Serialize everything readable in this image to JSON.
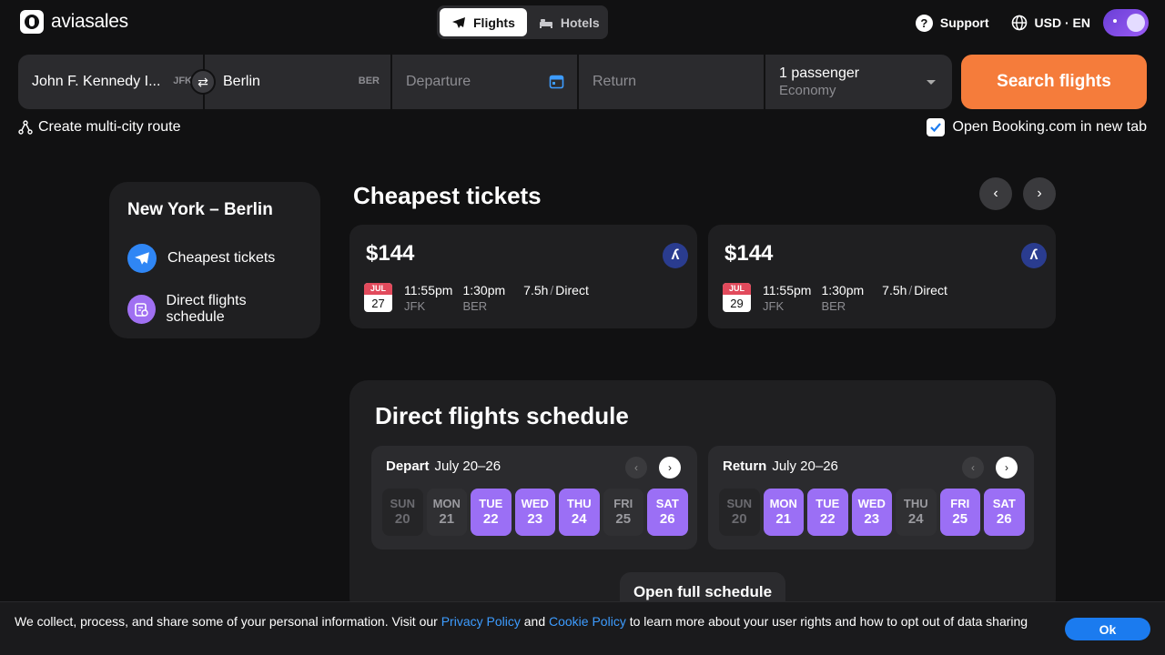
{
  "header": {
    "logo": "aviasales",
    "tabs": [
      {
        "label": "Flights",
        "active": true
      },
      {
        "label": "Hotels",
        "active": false
      }
    ],
    "support": "Support",
    "locale": "USD · EN"
  },
  "search": {
    "origin": "John F. Kennedy I...",
    "origin_code": "JFK",
    "destination": "Berlin",
    "destination_code": "BER",
    "departure_placeholder": "Departure",
    "return_placeholder": "Return",
    "passengers": "1 passenger",
    "cabin": "Economy",
    "button": "Search flights",
    "multi_city": "Create multi-city route",
    "booking_checkbox": "Open Booking.com in new tab",
    "booking_checked": true
  },
  "sidebar": {
    "title": "New York – Berlin",
    "items": [
      {
        "label": "Cheapest tickets",
        "color": "#2f86f5"
      },
      {
        "label": "Direct flights schedule",
        "color": "#a070f2"
      }
    ]
  },
  "cheapest": {
    "title": "Cheapest tickets",
    "cards": [
      {
        "price": "$144",
        "month": "JUL",
        "day": "27",
        "dep_time": "11:55pm",
        "dep_code": "JFK",
        "arr_time": "1:30pm",
        "arr_code": "BER",
        "duration": "7.5h",
        "type": "Direct"
      },
      {
        "price": "$144",
        "month": "JUL",
        "day": "29",
        "dep_time": "11:55pm",
        "dep_code": "JFK",
        "arr_time": "1:30pm",
        "arr_code": "BER",
        "duration": "7.5h",
        "type": "Direct"
      }
    ]
  },
  "schedule": {
    "title": "Direct flights schedule",
    "depart": {
      "label": "Depart",
      "range": "July 20–26",
      "days": [
        {
          "wd": "SUN",
          "n": "20",
          "state": "off"
        },
        {
          "wd": "MON",
          "n": "21",
          "state": "mid"
        },
        {
          "wd": "TUE",
          "n": "22",
          "state": "on"
        },
        {
          "wd": "WED",
          "n": "23",
          "state": "on"
        },
        {
          "wd": "THU",
          "n": "24",
          "state": "on"
        },
        {
          "wd": "FRI",
          "n": "25",
          "state": "mid"
        },
        {
          "wd": "SAT",
          "n": "26",
          "state": "on"
        }
      ]
    },
    "return": {
      "label": "Return",
      "range": "July 20–26",
      "days": [
        {
          "wd": "SUN",
          "n": "20",
          "state": "off"
        },
        {
          "wd": "MON",
          "n": "21",
          "state": "on"
        },
        {
          "wd": "TUE",
          "n": "22",
          "state": "on"
        },
        {
          "wd": "WED",
          "n": "23",
          "state": "on"
        },
        {
          "wd": "THU",
          "n": "24",
          "state": "mid"
        },
        {
          "wd": "FRI",
          "n": "25",
          "state": "on"
        },
        {
          "wd": "SAT",
          "n": "26",
          "state": "on"
        }
      ]
    },
    "open_button": "Open full schedule"
  },
  "cookie": {
    "text1": "We collect, process, and share some of your personal information. Visit our ",
    "privacy": "Privacy Policy",
    "and": " and ",
    "cookie_policy": "Cookie Policy",
    "text2": " to learn more about your user rights and how to opt out of data sharing",
    "ok": "Ok"
  },
  "colors": {
    "accent": "#f57c3b",
    "purple": "#9b6ff5",
    "link": "#3d9cff"
  }
}
